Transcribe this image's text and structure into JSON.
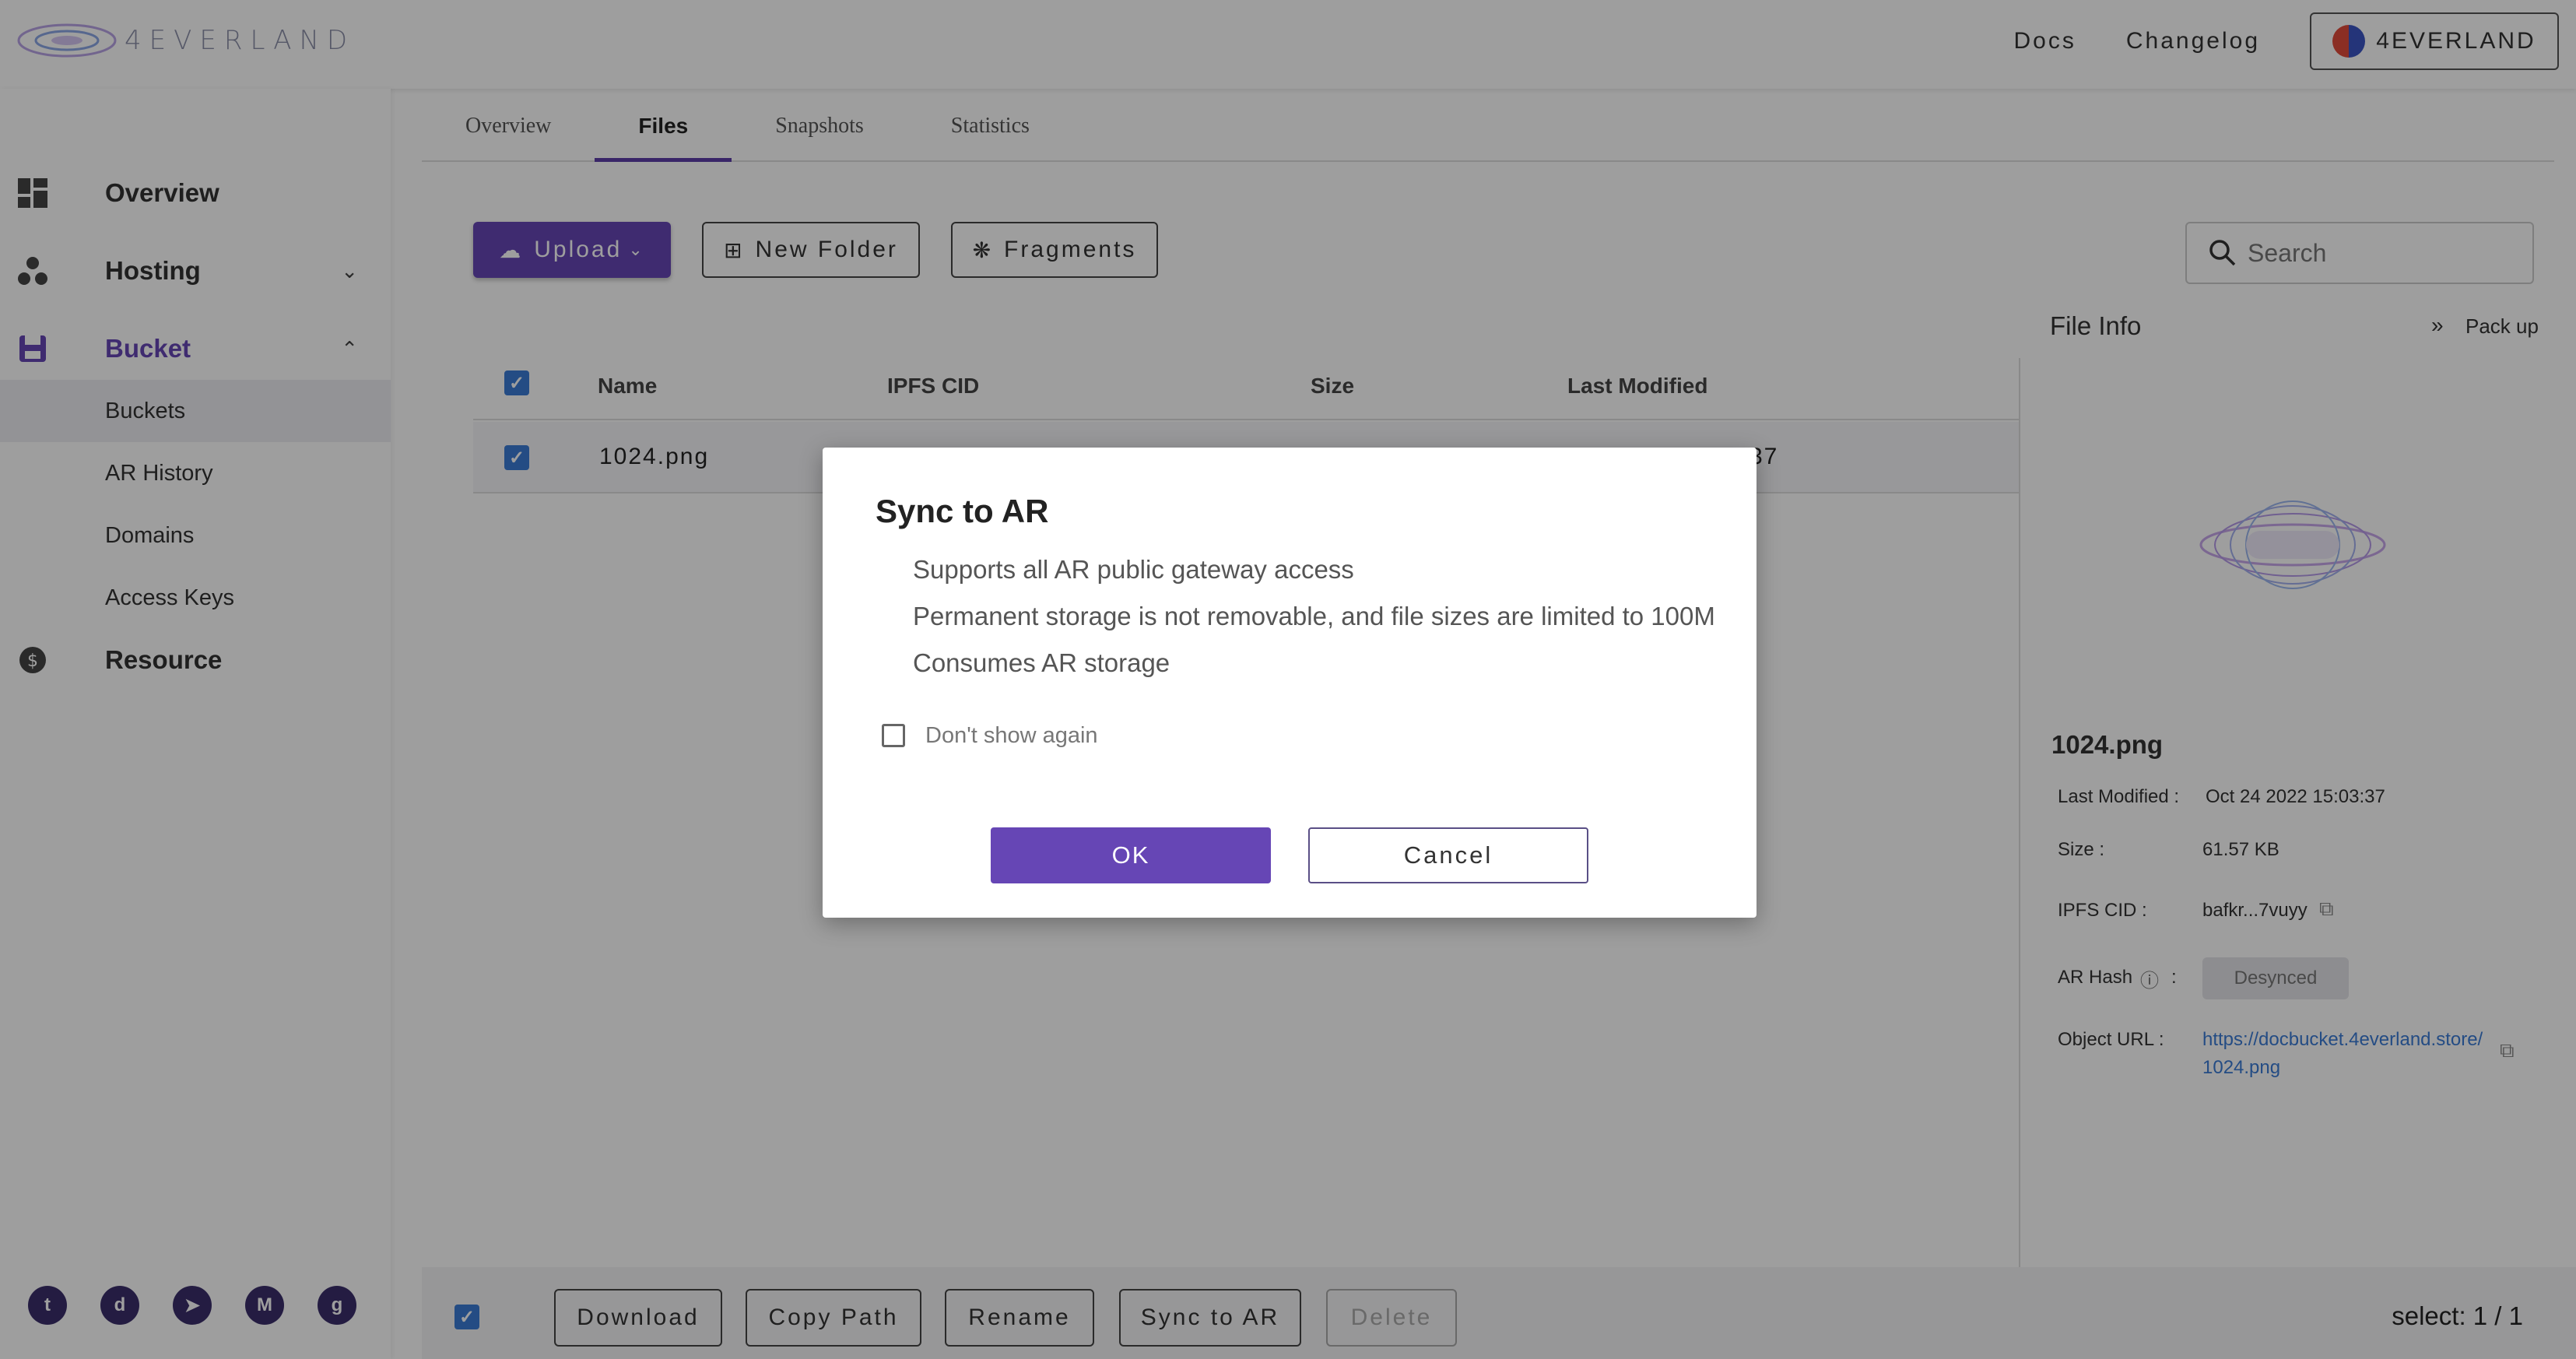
{
  "header": {
    "logo_text": "4EVERLAND",
    "links": [
      "Docs",
      "Changelog"
    ],
    "account_label": "4EVERLAND"
  },
  "sidebar": {
    "items": [
      {
        "label": "Overview",
        "icon": "dashboard-icon"
      },
      {
        "label": "Hosting",
        "icon": "hosting-icon"
      },
      {
        "label": "Bucket",
        "icon": "bucket-icon"
      },
      {
        "label": "Resource",
        "icon": "dollar-icon"
      }
    ],
    "bucket_sub": [
      "Buckets",
      "AR History",
      "Domains",
      "Access Keys"
    ],
    "socials": [
      "twitter-icon",
      "discord-icon",
      "telegram-icon",
      "medium-icon",
      "github-icon"
    ]
  },
  "tabs": [
    "Overview",
    "Files",
    "Snapshots",
    "Statistics"
  ],
  "toolbar": {
    "upload_label": "Upload",
    "new_folder_label": "New Folder",
    "fragments_label": "Fragments",
    "search_placeholder": "Search"
  },
  "table": {
    "columns": [
      "Name",
      "IPFS CID",
      "Size",
      "Last Modified"
    ],
    "rows": [
      {
        "name": "1024.png",
        "last_modified_fragment": "37"
      }
    ]
  },
  "file_info": {
    "title": "File Info",
    "pack_up": "Pack up",
    "name": "1024.png",
    "last_modified_label": "Last Modified :",
    "last_modified": "Oct 24 2022 15:03:37",
    "size_label": "Size :",
    "size": "61.57 KB",
    "cid_label": "IPFS CID :",
    "cid": "bafkr...7vuyy",
    "ar_hash_label": "AR Hash",
    "ar_hash_colon": ":",
    "ar_status": "Desynced",
    "url_label": "Object URL :",
    "url_line1": "https://docbucket.4everland.store/",
    "url_line2": "1024.png"
  },
  "bottom_bar": {
    "buttons": [
      "Download",
      "Copy Path",
      "Rename",
      "Sync to AR",
      "Delete"
    ],
    "select_count": "select: 1 / 1"
  },
  "modal": {
    "title": "Sync to AR",
    "lines": [
      "Supports all AR public gateway access",
      "Permanent storage is not removable, and file sizes are limited to 100M",
      "Consumes AR storage"
    ],
    "checkbox_label": "Don't show again",
    "ok_label": "OK",
    "cancel_label": "Cancel"
  },
  "colors": {
    "accent": "#6646b5",
    "checkbox": "#3a7bd5",
    "link": "#3a7bd5"
  }
}
